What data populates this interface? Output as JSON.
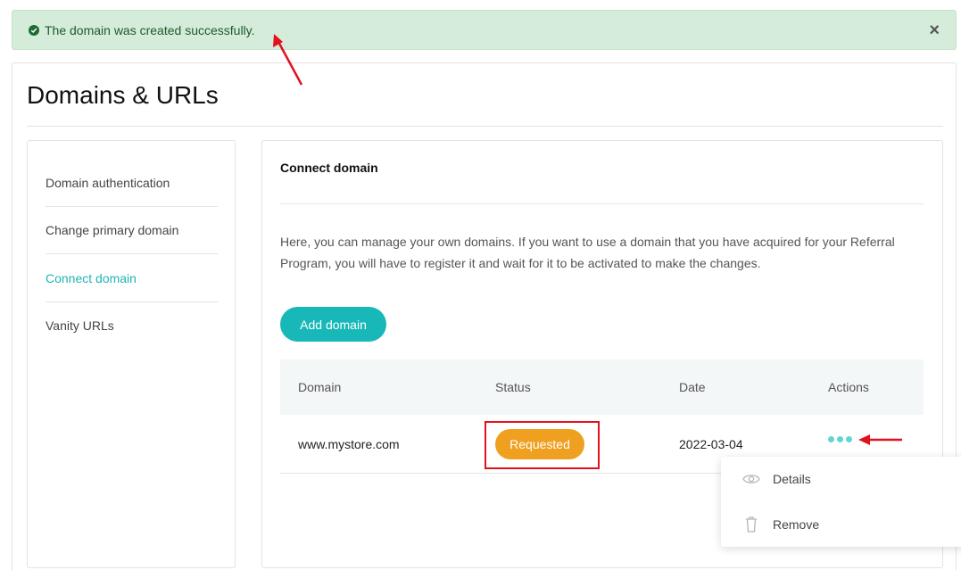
{
  "alert": {
    "message": "The domain was created successfully.",
    "close_symbol": "×",
    "icon": "check-circle-icon",
    "colors": {
      "background": "#d4ecd9",
      "text": "#1e5a2c"
    }
  },
  "page": {
    "title": "Domains & URLs"
  },
  "sidebar": {
    "items": [
      {
        "label": "Domain authentication",
        "active": false
      },
      {
        "label": "Change primary domain",
        "active": false
      },
      {
        "label": "Connect domain",
        "active": true
      },
      {
        "label": "Vanity URLs",
        "active": false
      }
    ]
  },
  "panel": {
    "title": "Connect domain",
    "description": "Here, you can manage your own domains. If you want to use a domain that you have acquired for your Referral Program, you will have to register it and wait for it to be activated to make the changes.",
    "add_button": "Add domain"
  },
  "table": {
    "columns": [
      "Domain",
      "Status",
      "Date",
      "Actions"
    ],
    "rows": [
      {
        "domain": "www.mystore.com",
        "status": "Requested",
        "date": "2022-03-04"
      }
    ]
  },
  "actions_menu": {
    "items": [
      {
        "label": "Details",
        "icon": "eye-icon"
      },
      {
        "label": "Remove",
        "icon": "trash-icon"
      }
    ]
  },
  "colors": {
    "accent": "#19b8b8",
    "status_requested": "#f0a020",
    "annotation": "#e3101e"
  }
}
